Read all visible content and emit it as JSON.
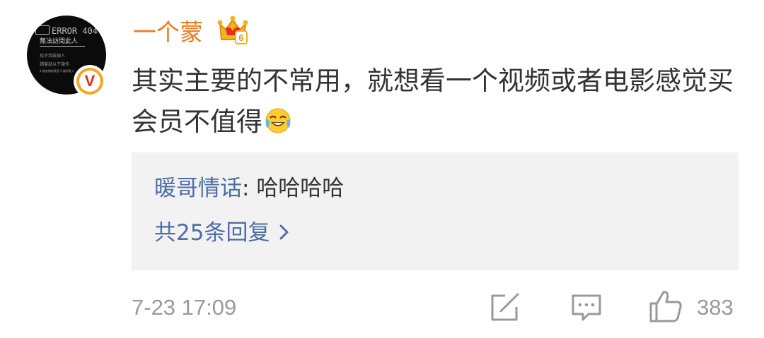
{
  "user": {
    "name": "一个蒙",
    "avatar_text": {
      "error": "ERROR 404",
      "line1": "無法訪問此人",
      "line2": "找不到該個人",
      "line3": "請嘗試以下操作",
      "line4": "1.檢查網絡連接 2.重新載入"
    },
    "verified_badge": "V",
    "level_badge": "6"
  },
  "comment": {
    "text": "其实主要的不常用，就想看一个视频或者电影感觉买会员不值得",
    "emoji": "laughing-crying-icon"
  },
  "reply_preview": {
    "user": "暖哥情话",
    "separator": ": ",
    "text": "哈哈哈哈",
    "more_label": "共25条回复"
  },
  "footer": {
    "timestamp": "7-23 17:09",
    "like_count": "383"
  },
  "colors": {
    "username": "#ef7a1f",
    "link": "#4e6ea5",
    "meta": "#999999",
    "reply_bg": "#f2f2f2"
  }
}
